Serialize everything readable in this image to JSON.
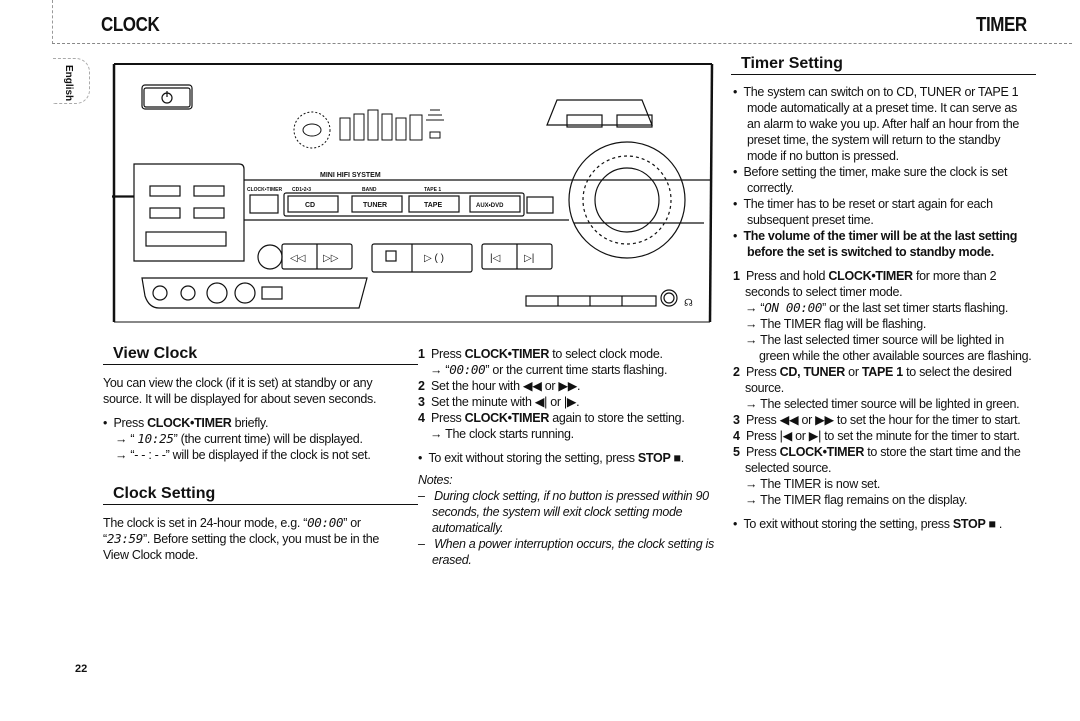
{
  "header": {
    "left_title": "CLOCK",
    "right_title": "TIMER",
    "language_tab": "English"
  },
  "device_illustration": {
    "brand_label": "MINI HIFI SYSTEM",
    "source_labels": [
      "CLOCK•TIMER",
      "CD1•2•3",
      "BAND",
      "TAPE 1"
    ],
    "source_buttons": [
      "CD",
      "TUNER",
      "TAPE",
      "AUX•DVD"
    ],
    "icons": [
      "power-icon",
      "rewind-icon",
      "fast-forward-icon",
      "stop-icon",
      "play-pause-icon",
      "previous-icon",
      "next-icon",
      "headphones-icon"
    ]
  },
  "view_clock": {
    "title": "View Clock",
    "intro": "You can view the clock (if it is set) at standby or any source. It will be displayed for about seven seconds.",
    "bullet_prefix": "Press ",
    "bullet_key": "CLOCK•TIMER",
    "bullet_suffix": " briefly.",
    "result1_pre": "“ ",
    "result1_lcd": "10:25",
    "result1_post": "” (the current time) will be displayed.",
    "result2_pre": "“",
    "result2_lcd": "- - : - -",
    "result2_post": "” will be displayed if the clock is not set."
  },
  "clock_setting": {
    "title": "Clock Setting",
    "intro_pre": "The clock is set in 24-hour mode, e.g. “",
    "intro_lcd1": "00:00",
    "intro_mid": "” or “",
    "intro_lcd2": "23:59",
    "intro_post": "”. Before setting the clock, you must be in the View Clock mode.",
    "steps": {
      "s1_num": "1",
      "s1_pre": "Press ",
      "s1_key": "CLOCK•TIMER",
      "s1_post": " to select clock mode.",
      "s1_r_pre": "“",
      "s1_r_lcd": "00:00",
      "s1_r_post": "” or the current time starts flashing.",
      "s2_num": "2",
      "s2_text": "Set the hour with ◀◀ or ▶▶.",
      "s3_num": "3",
      "s3_text": "Set the minute with ◀| or |▶.",
      "s4_num": "4",
      "s4_pre": "Press ",
      "s4_key": "CLOCK•TIMER",
      "s4_post": " again to store the setting.",
      "s4_r": "The clock starts running."
    },
    "exit_pre": "To exit without storing the setting, press ",
    "exit_key": "STOP ■",
    "exit_post": ".",
    "notes_title": "Notes:",
    "note1": "During clock setting,  if no button is pressed within 90 seconds, the system will exit clock setting mode automatically.",
    "note2": "When a power interruption occurs, the clock setting is erased."
  },
  "timer_setting": {
    "title": "Timer Setting",
    "bullet1": "The system can switch on to CD, TUNER or TAPE 1 mode automatically at a preset time. It can serve as an alarm to wake you up. After half an hour from the preset time, the system will return to the standby mode if no button is pressed.",
    "bullet2": "Before setting the timer, make sure the clock is set correctly.",
    "bullet3": "The timer has to be reset or start again for each subsequent preset time.",
    "bullet4": "The volume of the timer will be at the last setting before the set is switched to standby mode.",
    "s1_num": "1",
    "s1_pre": "Press and hold ",
    "s1_key": "CLOCK•TIMER",
    "s1_post": " for more than 2 seconds to select timer mode.",
    "s1_r1_pre": "“",
    "s1_r1_lcd": "ON  00:00",
    "s1_r1_post": "” or the last set timer starts flashing.",
    "s1_r2": "The TIMER flag will be flashing.",
    "s1_r3": "The last selected timer source will be lighted in green while the other available sources are flashing.",
    "s2_num": "2",
    "s2_pre": "Press ",
    "s2_key": "CD, TUNER",
    "s2_mid": " or ",
    "s2_key2": "TAPE 1",
    "s2_post": " to select the desired source.",
    "s2_r": "The selected timer source will be lighted in green.",
    "s3_num": "3",
    "s3_text": "Press ◀◀ or ▶▶ to set the hour for the timer to start.",
    "s4_num": "4",
    "s4_text": "Press |◀ or ▶| to set the minute for the timer to start.",
    "s5_num": "5",
    "s5_pre": "Press ",
    "s5_key": "CLOCK•TIMER",
    "s5_post": " to store the start time and the selected source.",
    "s5_r1": "The TIMER is now set.",
    "s5_r2": "The TIMER flag remains on the display.",
    "exit_pre": "To exit without storing the setting, press ",
    "exit_key": "STOP ■",
    "exit_post": " ."
  },
  "footer": {
    "page_number": "22"
  }
}
